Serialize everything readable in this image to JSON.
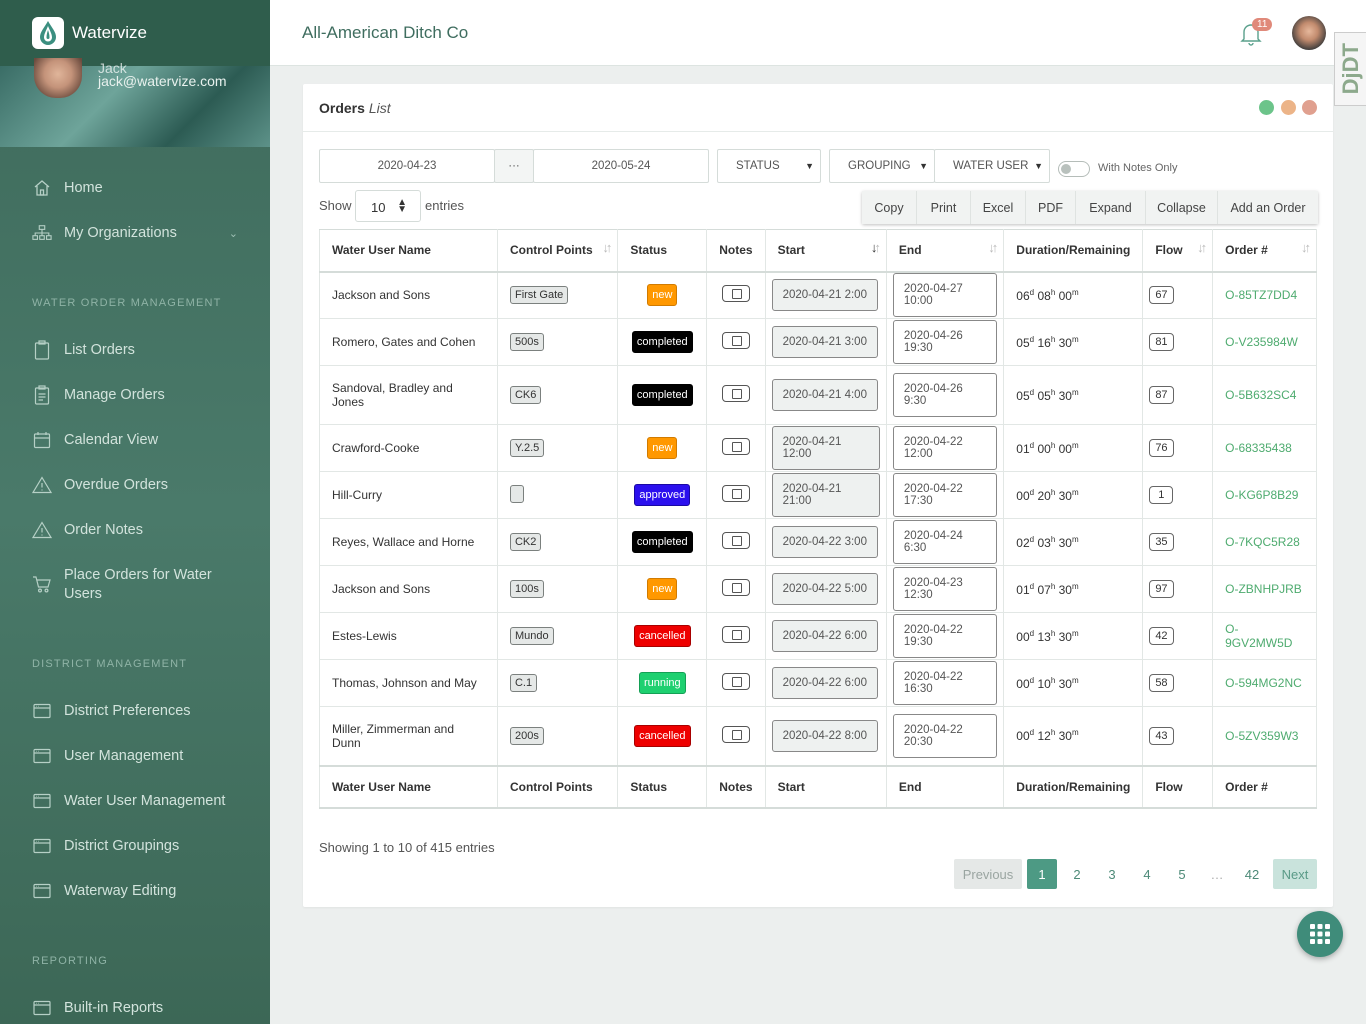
{
  "app": {
    "name": "Watervize"
  },
  "user": {
    "name": "Jack",
    "email": "jack@watervize.com"
  },
  "header": {
    "org_title": "All-American Ditch Co",
    "notification_count": "11"
  },
  "devtools": {
    "label": "DjDT"
  },
  "sidebar": {
    "items": [
      {
        "label": "Home",
        "icon": "home-icon"
      },
      {
        "label": "My Organizations",
        "icon": "sitemap-icon"
      }
    ],
    "sections": [
      {
        "title": "WATER ORDER MANAGEMENT",
        "items": [
          {
            "label": "List Orders",
            "icon": "clipboard-icon"
          },
          {
            "label": "Manage Orders",
            "icon": "clipboard-list-icon"
          },
          {
            "label": "Calendar View",
            "icon": "calendar-icon"
          },
          {
            "label": "Overdue Orders",
            "icon": "warning-icon"
          },
          {
            "label": "Order Notes",
            "icon": "warning-icon"
          },
          {
            "label": "Place Orders for Water Users",
            "icon": "cart-icon"
          }
        ]
      },
      {
        "title": "DISTRICT MANAGEMENT",
        "items": [
          {
            "label": "District Preferences",
            "icon": "window-icon"
          },
          {
            "label": "User Management",
            "icon": "window-icon"
          },
          {
            "label": "Water User Management",
            "icon": "window-icon"
          },
          {
            "label": "District Groupings",
            "icon": "window-icon"
          },
          {
            "label": "Waterway Editing",
            "icon": "window-icon"
          }
        ]
      },
      {
        "title": "REPORTING",
        "items": [
          {
            "label": "Built-in Reports",
            "icon": "window-icon"
          }
        ]
      }
    ]
  },
  "card": {
    "title": "Orders",
    "subtitle": "List",
    "window_dots": [
      "#6cc48a",
      "#ecb488",
      "#e0a08f"
    ]
  },
  "filters": {
    "date_from": "2020-04-23",
    "date_sep": "···",
    "date_to": "2020-05-24",
    "status": "STATUS",
    "grouping": "GROUPING",
    "water_user": "WATER USER",
    "with_notes_label": "With Notes Only"
  },
  "length": {
    "show": "Show",
    "value": "10",
    "entries": "entries"
  },
  "buttons": [
    "Copy",
    "Print",
    "Excel",
    "PDF",
    "Expand",
    "Collapse",
    "Add an Order"
  ],
  "table": {
    "columns": [
      "Water User Name",
      "Control Points",
      "Status",
      "Notes",
      "Start",
      "End",
      "Duration/Remaining",
      "Flow",
      "Order #"
    ],
    "rows": [
      {
        "user": "Jackson and Sons",
        "cp": "First Gate",
        "status": "new",
        "start": "2020-04-21 2:00",
        "end": "2020-04-27 10:00",
        "d": "06",
        "h": "08",
        "m": "00",
        "flow": "67",
        "order": "O-85TZ7DD4"
      },
      {
        "user": "Romero, Gates and Cohen",
        "cp": "500s",
        "status": "completed",
        "start": "2020-04-21 3:00",
        "end": "2020-04-26 19:30",
        "d": "05",
        "h": "16",
        "m": "30",
        "flow": "81",
        "order": "O-V235984W"
      },
      {
        "user": "Sandoval, Bradley and Jones",
        "cp": "CK6",
        "status": "completed",
        "start": "2020-04-21 4:00",
        "end": "2020-04-26 9:30",
        "d": "05",
        "h": "05",
        "m": "30",
        "flow": "87",
        "order": "O-5B632SC4"
      },
      {
        "user": "Crawford-Cooke",
        "cp": "Y.2.5",
        "status": "new",
        "start": "2020-04-21 12:00",
        "end": "2020-04-22 12:00",
        "d": "01",
        "h": "00",
        "m": "00",
        "flow": "76",
        "order": "O-68335438"
      },
      {
        "user": "Hill-Curry",
        "cp": "",
        "status": "approved",
        "start": "2020-04-21 21:00",
        "end": "2020-04-22 17:30",
        "d": "00",
        "h": "20",
        "m": "30",
        "flow": "1",
        "order": "O-KG6P8B29"
      },
      {
        "user": "Reyes, Wallace and Horne",
        "cp": "CK2",
        "status": "completed",
        "start": "2020-04-22 3:00",
        "end": "2020-04-24 6:30",
        "d": "02",
        "h": "03",
        "m": "30",
        "flow": "35",
        "order": "O-7KQC5R28"
      },
      {
        "user": "Jackson and Sons",
        "cp": "100s",
        "status": "new",
        "start": "2020-04-22 5:00",
        "end": "2020-04-23 12:30",
        "d": "01",
        "h": "07",
        "m": "30",
        "flow": "97",
        "order": "O-ZBNHPJRB"
      },
      {
        "user": "Estes-Lewis",
        "cp": "Mundo",
        "status": "cancelled",
        "start": "2020-04-22 6:00",
        "end": "2020-04-22 19:30",
        "d": "00",
        "h": "13",
        "m": "30",
        "flow": "42",
        "order": "O-9GV2MW5D"
      },
      {
        "user": "Thomas, Johnson and May",
        "cp": "C.1",
        "status": "running",
        "start": "2020-04-22 6:00",
        "end": "2020-04-22 16:30",
        "d": "00",
        "h": "10",
        "m": "30",
        "flow": "58",
        "order": "O-594MG2NC"
      },
      {
        "user": "Miller, Zimmerman and Dunn",
        "cp": "200s",
        "status": "cancelled",
        "start": "2020-04-22 8:00",
        "end": "2020-04-22 20:30",
        "d": "00",
        "h": "12",
        "m": "30",
        "flow": "43",
        "order": "O-5ZV359W3"
      }
    ]
  },
  "info": "Showing 1 to 10 of 415 entries",
  "pagination": {
    "previous": "Previous",
    "pages": [
      "1",
      "2",
      "3",
      "4",
      "5",
      "…",
      "42"
    ],
    "next": "Next"
  }
}
